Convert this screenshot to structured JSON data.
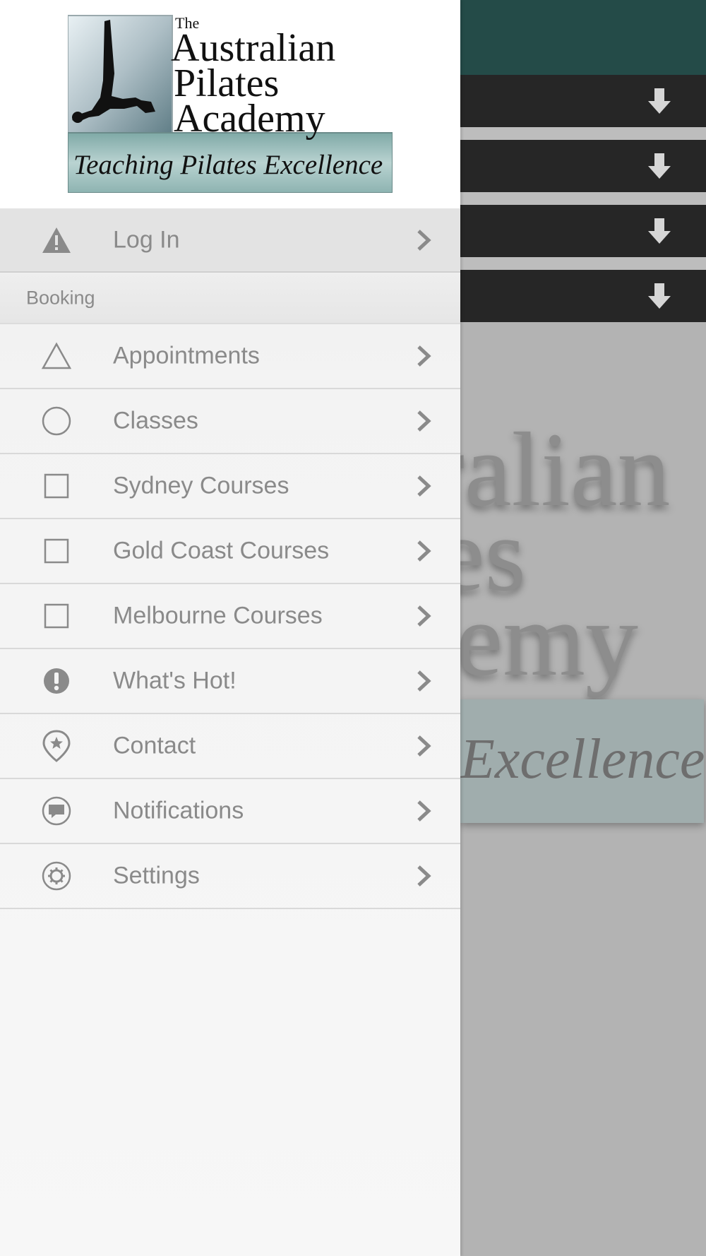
{
  "logo": {
    "line1": "The",
    "line2": "Australian",
    "line3": "Pilates",
    "line4": "Academy",
    "tagline": "Teaching Pilates Excellence"
  },
  "menu": {
    "login": {
      "label": "Log In",
      "icon": "warning-icon"
    },
    "section_label": "Booking",
    "items": [
      {
        "label": "Appointments",
        "icon": "triangle-outline-icon"
      },
      {
        "label": "Classes",
        "icon": "circle-outline-icon"
      },
      {
        "label": "Sydney Courses",
        "icon": "square-outline-icon"
      },
      {
        "label": "Gold Coast Courses",
        "icon": "square-outline-icon"
      },
      {
        "label": "Melbourne Courses",
        "icon": "square-outline-icon"
      },
      {
        "label": "What's Hot!",
        "icon": "exclamation-circle-icon"
      },
      {
        "label": "Contact",
        "icon": "map-pin-star-icon"
      },
      {
        "label": "Notifications",
        "icon": "chat-bubble-icon"
      },
      {
        "label": "Settings",
        "icon": "gear-icon"
      }
    ]
  },
  "background": {
    "logo_fragment_lines": [
      "ralian",
      "es",
      "lemy"
    ],
    "tagline_fragment": "Excellence"
  },
  "colors": {
    "header": "#244b48",
    "bars": "#262626",
    "text": "#8a8a8a"
  }
}
